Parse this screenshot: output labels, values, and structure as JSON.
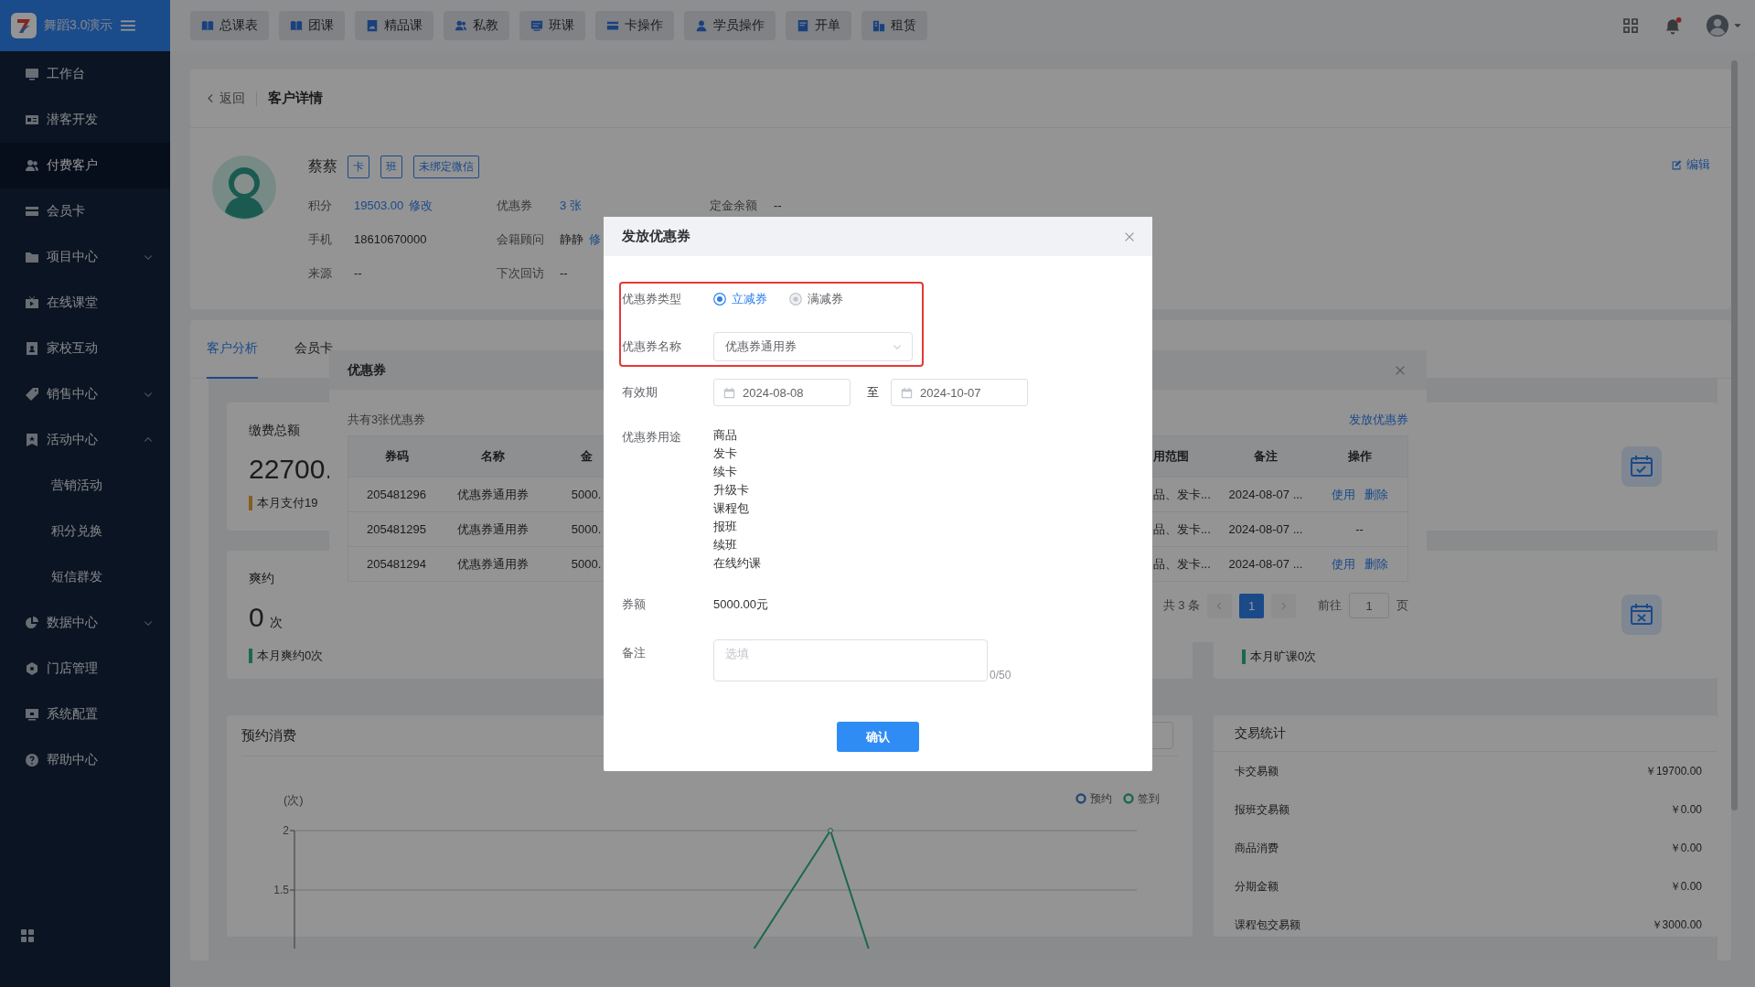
{
  "sidebar": {
    "app_name": "舞蹈3.0演示",
    "items": [
      {
        "label": "工作台",
        "selected": false
      },
      {
        "label": "潜客开发",
        "selected": false
      },
      {
        "label": "付费客户",
        "selected": true
      },
      {
        "label": "会员卡",
        "selected": false
      },
      {
        "label": "项目中心",
        "selected": false,
        "expanded": false
      },
      {
        "label": "在线课堂",
        "selected": false
      },
      {
        "label": "家校互动",
        "selected": false
      },
      {
        "label": "销售中心",
        "selected": false,
        "expanded": false
      },
      {
        "label": "活动中心",
        "selected": false,
        "expanded": true,
        "children": [
          {
            "label": "营销活动",
            "selected": false
          },
          {
            "label": "积分兑换",
            "selected": false
          },
          {
            "label": "短信群发",
            "selected": false
          }
        ]
      },
      {
        "label": "数据中心",
        "selected": false,
        "expanded": false
      },
      {
        "label": "门店管理",
        "selected": false
      },
      {
        "label": "系统配置",
        "selected": false
      },
      {
        "label": "帮助中心",
        "selected": false
      }
    ]
  },
  "topbar": {
    "nav": [
      "总课表",
      "团课",
      "精品课",
      "私教",
      "班课",
      "卡操作",
      "学员操作",
      "开单",
      "租赁"
    ]
  },
  "customer": {
    "back": "返回",
    "title": "客户详情",
    "name": "蔡蔡",
    "tags": [
      "卡",
      "班",
      "未绑定微信"
    ],
    "edit": "编辑",
    "rows": [
      [
        {
          "label": "积分",
          "value": "19503.00",
          "value_is_link": true,
          "link": "修改"
        },
        {
          "label": "优惠券",
          "value": "3 张",
          "value_is_link": true
        },
        {
          "label": "定金余额",
          "value": "--",
          "value_is_link": false
        }
      ],
      [
        {
          "label": "手机",
          "value": "18610670000",
          "value_is_link": false
        },
        {
          "label": "会籍顾问",
          "value": "静静",
          "value_is_link": false,
          "link": "修"
        }
      ],
      [
        {
          "label": "来源",
          "value": "--",
          "value_is_link": false
        },
        {
          "label": "下次回访",
          "value": "--",
          "value_is_link": false
        }
      ]
    ]
  },
  "analysis": {
    "tabs": [
      {
        "label": "客户分析",
        "selected": true
      },
      {
        "label": "会员卡",
        "selected": false
      }
    ],
    "stat_cards": [
      {
        "kind": "main",
        "title": "缴费总额",
        "value": "22700.",
        "note": "本月支付19",
        "color": "#855e23"
      },
      {
        "kind": "main",
        "title": "爽约",
        "value": "0",
        "unit": "次",
        "note": "本月爽约0次",
        "color": "#1b684d"
      },
      {
        "kind": "side",
        "note": "本月旷课0次",
        "color": "#1b684d"
      }
    ],
    "booking_chart": {
      "title": "预约消费",
      "unit": "(次)",
      "yticks": [
        "2",
        "1.5"
      ],
      "legend": [
        {
          "label": "预约",
          "color": "#224a72"
        },
        {
          "label": "签到",
          "color": "#1b684d"
        }
      ]
    },
    "transactions": {
      "title": "交易统计",
      "rows": [
        {
          "label": "卡交易额",
          "value": "￥19700.00"
        },
        {
          "label": "报班交易额",
          "value": "￥0.00"
        },
        {
          "label": "商品消费",
          "value": "￥0.00"
        },
        {
          "label": "分期金额",
          "value": "￥0.00"
        },
        {
          "label": "课程包交易额",
          "value": "￥3000.00"
        }
      ]
    }
  },
  "coupon_dialog": {
    "title": "优惠券",
    "summary": "共有3张优惠券",
    "issue_link": "发放优惠券",
    "columns_left": [
      "券码",
      "名称",
      "金"
    ],
    "columns_right": [
      "用范围",
      "备注",
      "操作"
    ],
    "rows": [
      {
        "code": "205481296",
        "name": "优惠券通用券",
        "amount": "5000.",
        "scope": "品、发卡...",
        "remark": "2024-08-07 ...",
        "actions": [
          {
            "label": "使用",
            "kind": "link"
          },
          {
            "label": "删除",
            "kind": "link"
          }
        ]
      },
      {
        "code": "205481295",
        "name": "优惠券通用券",
        "amount": "5000.",
        "scope": "品、发卡...",
        "remark": "2024-08-07 ...",
        "actions": [
          {
            "label": "--",
            "kind": "text"
          }
        ]
      },
      {
        "code": "205481294",
        "name": "优惠券通用券",
        "amount": "5000.",
        "scope": "品、发卡...",
        "remark": "2024-08-07 ...",
        "actions": [
          {
            "label": "使用",
            "kind": "link"
          },
          {
            "label": "删除",
            "kind": "link"
          }
        ]
      }
    ],
    "pagination": {
      "total": "共 3 条",
      "pages": [
        {
          "label": "1",
          "selected": true
        }
      ],
      "goto_label": "前往",
      "goto_value": "1",
      "page_unit": "页"
    }
  },
  "issue_modal": {
    "title": "发放优惠券",
    "fields": [
      {
        "kind": "radio",
        "label": "优惠券类型",
        "highlighted": true,
        "options": [
          {
            "label": "立减券",
            "selected": true,
            "disabled": false
          },
          {
            "label": "满减券",
            "selected": false,
            "disabled": true
          }
        ]
      },
      {
        "kind": "select",
        "label": "优惠券名称",
        "highlighted": true,
        "value": "优惠券通用券"
      },
      {
        "kind": "date_range",
        "label": "有效期",
        "start": "2024-08-08",
        "separator": "至",
        "end": "2024-10-07"
      },
      {
        "kind": "list",
        "label": "优惠券用途",
        "items": [
          "商品",
          "发卡",
          "续卡",
          "升级卡",
          "课程包",
          "报班",
          "续班",
          "在线约课"
        ]
      },
      {
        "kind": "text",
        "label": "券额",
        "value": "5000.00元"
      },
      {
        "kind": "textarea",
        "label": "备注",
        "placeholder": "选填",
        "counter": "0/50"
      }
    ],
    "confirm": "确认"
  }
}
